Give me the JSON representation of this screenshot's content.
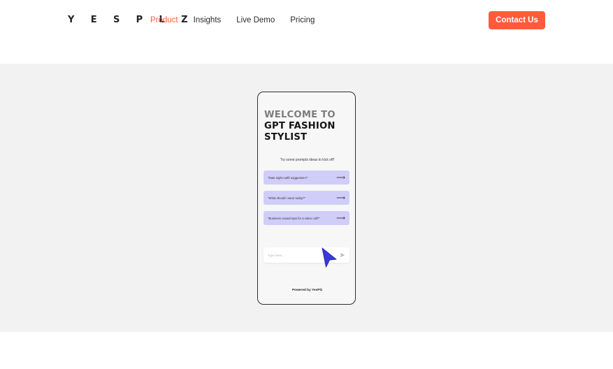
{
  "header": {
    "logo": "Y E S P L Z",
    "nav": [
      {
        "label": "Product",
        "active": true
      },
      {
        "label": "Insights",
        "active": false
      },
      {
        "label": "Live Demo",
        "active": false
      },
      {
        "label": "Pricing",
        "active": false
      }
    ],
    "contact_label": "Contact Us"
  },
  "phone": {
    "title_line1": "WELCOME TO",
    "title_line2": "GPT FASHION",
    "title_line3": "STYLIST",
    "prompt_hint": "Try some prompts ideas to kick off!",
    "prompts": [
      {
        "text": "\"Date night outfit suggestion?\"",
        "arrow": "⟶"
      },
      {
        "text": "\"What should I wear today?\"",
        "arrow": "⟶"
      },
      {
        "text": "\"Business casual tops for a video call?\"",
        "arrow": "⟶"
      }
    ],
    "input_placeholder": "Type here...",
    "send_icon": "send-icon",
    "powered_by": "Powered by YesPlz"
  },
  "colors": {
    "accent": "#ff5a3c",
    "hero_bg": "#f2f2f2",
    "chip_bg": "#d0cdf9",
    "cursor": "#3a3ad6"
  }
}
